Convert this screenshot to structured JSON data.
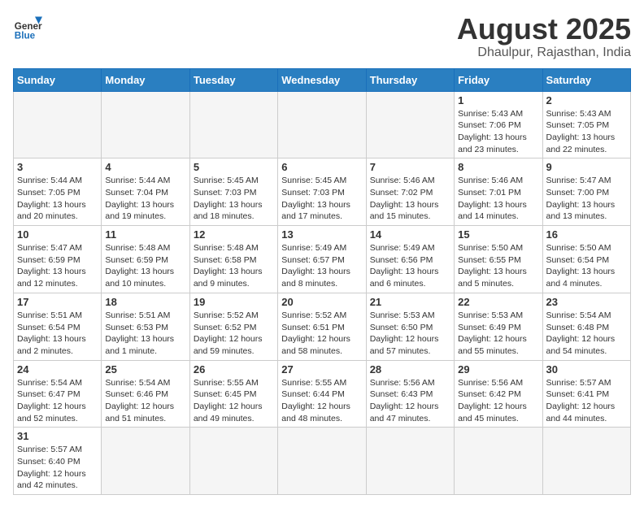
{
  "logo": {
    "general": "General",
    "blue": "Blue"
  },
  "header": {
    "title": "August 2025",
    "subtitle": "Dhaulpur, Rajasthan, India"
  },
  "weekdays": [
    "Sunday",
    "Monday",
    "Tuesday",
    "Wednesday",
    "Thursday",
    "Friday",
    "Saturday"
  ],
  "weeks": [
    [
      {
        "day": "",
        "info": ""
      },
      {
        "day": "",
        "info": ""
      },
      {
        "day": "",
        "info": ""
      },
      {
        "day": "",
        "info": ""
      },
      {
        "day": "",
        "info": ""
      },
      {
        "day": "1",
        "info": "Sunrise: 5:43 AM\nSunset: 7:06 PM\nDaylight: 13 hours and 23 minutes."
      },
      {
        "day": "2",
        "info": "Sunrise: 5:43 AM\nSunset: 7:05 PM\nDaylight: 13 hours and 22 minutes."
      }
    ],
    [
      {
        "day": "3",
        "info": "Sunrise: 5:44 AM\nSunset: 7:05 PM\nDaylight: 13 hours and 20 minutes."
      },
      {
        "day": "4",
        "info": "Sunrise: 5:44 AM\nSunset: 7:04 PM\nDaylight: 13 hours and 19 minutes."
      },
      {
        "day": "5",
        "info": "Sunrise: 5:45 AM\nSunset: 7:03 PM\nDaylight: 13 hours and 18 minutes."
      },
      {
        "day": "6",
        "info": "Sunrise: 5:45 AM\nSunset: 7:03 PM\nDaylight: 13 hours and 17 minutes."
      },
      {
        "day": "7",
        "info": "Sunrise: 5:46 AM\nSunset: 7:02 PM\nDaylight: 13 hours and 15 minutes."
      },
      {
        "day": "8",
        "info": "Sunrise: 5:46 AM\nSunset: 7:01 PM\nDaylight: 13 hours and 14 minutes."
      },
      {
        "day": "9",
        "info": "Sunrise: 5:47 AM\nSunset: 7:00 PM\nDaylight: 13 hours and 13 minutes."
      }
    ],
    [
      {
        "day": "10",
        "info": "Sunrise: 5:47 AM\nSunset: 6:59 PM\nDaylight: 13 hours and 12 minutes."
      },
      {
        "day": "11",
        "info": "Sunrise: 5:48 AM\nSunset: 6:59 PM\nDaylight: 13 hours and 10 minutes."
      },
      {
        "day": "12",
        "info": "Sunrise: 5:48 AM\nSunset: 6:58 PM\nDaylight: 13 hours and 9 minutes."
      },
      {
        "day": "13",
        "info": "Sunrise: 5:49 AM\nSunset: 6:57 PM\nDaylight: 13 hours and 8 minutes."
      },
      {
        "day": "14",
        "info": "Sunrise: 5:49 AM\nSunset: 6:56 PM\nDaylight: 13 hours and 6 minutes."
      },
      {
        "day": "15",
        "info": "Sunrise: 5:50 AM\nSunset: 6:55 PM\nDaylight: 13 hours and 5 minutes."
      },
      {
        "day": "16",
        "info": "Sunrise: 5:50 AM\nSunset: 6:54 PM\nDaylight: 13 hours and 4 minutes."
      }
    ],
    [
      {
        "day": "17",
        "info": "Sunrise: 5:51 AM\nSunset: 6:54 PM\nDaylight: 13 hours and 2 minutes."
      },
      {
        "day": "18",
        "info": "Sunrise: 5:51 AM\nSunset: 6:53 PM\nDaylight: 13 hours and 1 minute."
      },
      {
        "day": "19",
        "info": "Sunrise: 5:52 AM\nSunset: 6:52 PM\nDaylight: 12 hours and 59 minutes."
      },
      {
        "day": "20",
        "info": "Sunrise: 5:52 AM\nSunset: 6:51 PM\nDaylight: 12 hours and 58 minutes."
      },
      {
        "day": "21",
        "info": "Sunrise: 5:53 AM\nSunset: 6:50 PM\nDaylight: 12 hours and 57 minutes."
      },
      {
        "day": "22",
        "info": "Sunrise: 5:53 AM\nSunset: 6:49 PM\nDaylight: 12 hours and 55 minutes."
      },
      {
        "day": "23",
        "info": "Sunrise: 5:54 AM\nSunset: 6:48 PM\nDaylight: 12 hours and 54 minutes."
      }
    ],
    [
      {
        "day": "24",
        "info": "Sunrise: 5:54 AM\nSunset: 6:47 PM\nDaylight: 12 hours and 52 minutes."
      },
      {
        "day": "25",
        "info": "Sunrise: 5:54 AM\nSunset: 6:46 PM\nDaylight: 12 hours and 51 minutes."
      },
      {
        "day": "26",
        "info": "Sunrise: 5:55 AM\nSunset: 6:45 PM\nDaylight: 12 hours and 49 minutes."
      },
      {
        "day": "27",
        "info": "Sunrise: 5:55 AM\nSunset: 6:44 PM\nDaylight: 12 hours and 48 minutes."
      },
      {
        "day": "28",
        "info": "Sunrise: 5:56 AM\nSunset: 6:43 PM\nDaylight: 12 hours and 47 minutes."
      },
      {
        "day": "29",
        "info": "Sunrise: 5:56 AM\nSunset: 6:42 PM\nDaylight: 12 hours and 45 minutes."
      },
      {
        "day": "30",
        "info": "Sunrise: 5:57 AM\nSunset: 6:41 PM\nDaylight: 12 hours and 44 minutes."
      }
    ],
    [
      {
        "day": "31",
        "info": "Sunrise: 5:57 AM\nSunset: 6:40 PM\nDaylight: 12 hours and 42 minutes."
      },
      {
        "day": "",
        "info": ""
      },
      {
        "day": "",
        "info": ""
      },
      {
        "day": "",
        "info": ""
      },
      {
        "day": "",
        "info": ""
      },
      {
        "day": "",
        "info": ""
      },
      {
        "day": "",
        "info": ""
      }
    ]
  ]
}
